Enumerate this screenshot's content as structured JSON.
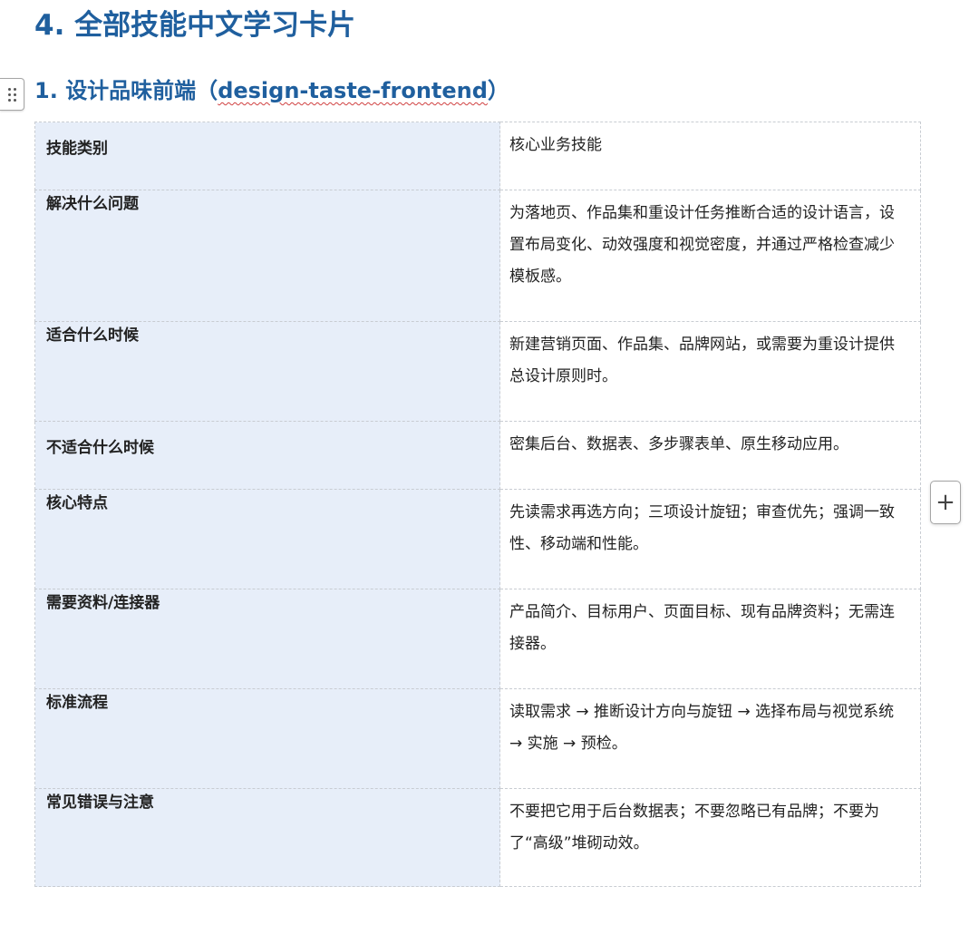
{
  "document": {
    "title": "4. 全部技能中文学习卡片"
  },
  "section": {
    "number": "1.",
    "name": "设计品味前端（",
    "skill_id": "design-taste-frontend",
    "close": "）"
  },
  "card_rows": [
    {
      "key": "技能类别",
      "value": "核心业务技能"
    },
    {
      "key": "解决什么问题",
      "value": "为落地页、作品集和重设计任务推断合适的设计语言，设置布局变化、动效强度和视觉密度，并通过严格检查减少模板感。"
    },
    {
      "key": "适合什么时候",
      "value": "新建营销页面、作品集、品牌网站，或需要为重设计提供总设计原则时。"
    },
    {
      "key": "不适合什么时候",
      "value": "密集后台、数据表、多步骤表单、原生移动应用。"
    },
    {
      "key": "核心特点",
      "value": "先读需求再选方向；三项设计旋钮；审查优先；强调一致性、移动端和性能。"
    },
    {
      "key": "需要资料/连接器",
      "value": "产品简介、目标用户、页面目标、现有品牌资料；无需连接器。"
    },
    {
      "key": "标准流程",
      "value": "读取需求 → 推断设计方向与旋钮 → 选择布局与视觉系统 → 实施 → 预检。"
    },
    {
      "key": "常见错误与注意",
      "value": "不要把它用于后台数据表；不要忽略已有品牌；不要为了“高级”堆砌动效。"
    }
  ],
  "icons": {
    "drag_handle": "drag-dots-icon",
    "add": "plus-icon"
  },
  "colors": {
    "heading": "#1f5f9e",
    "key_cell_bg": "#e7eef9"
  }
}
